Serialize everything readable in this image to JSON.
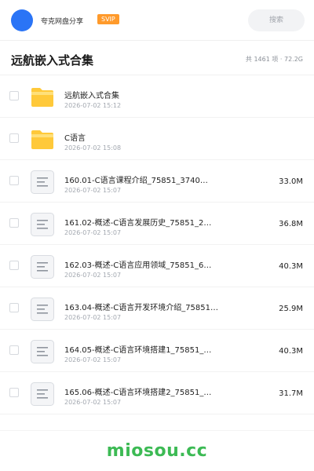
{
  "header": {
    "share_title": "夸克网盘分享",
    "badge": "SVIP",
    "search_placeholder": "搜索"
  },
  "folder": {
    "title": "远航嵌入式合集",
    "summary": "共 1461 项 · 72.2G"
  },
  "files": [
    {
      "type": "folder",
      "name": "远航嵌入式合集",
      "date": "2026-07-02 15:12",
      "size": ""
    },
    {
      "type": "folder",
      "name": "C语言",
      "date": "2026-07-02 15:08",
      "size": ""
    },
    {
      "type": "doc",
      "name": "160.01-C语言课程介绍_75851_3740…",
      "date": "2026-07-02 15:07",
      "size": "33.0M"
    },
    {
      "type": "doc",
      "name": "161.02-概述-C语言发展历史_75851_2…",
      "date": "2026-07-02 15:07",
      "size": "36.8M"
    },
    {
      "type": "doc",
      "name": "162.03-概述-C语言应用领域_75851_6…",
      "date": "2026-07-02 15:07",
      "size": "40.3M"
    },
    {
      "type": "doc",
      "name": "163.04-概述-C语言开发环境介绍_75851…",
      "date": "2026-07-02 15:07",
      "size": "25.9M"
    },
    {
      "type": "doc",
      "name": "164.05-概述-C语言环境搭建1_75851_…",
      "date": "2026-07-02 15:07",
      "size": "40.3M"
    },
    {
      "type": "doc",
      "name": "165.06-概述-C语言环境搭建2_75851_…",
      "date": "2026-07-02 15:07",
      "size": "31.7M"
    }
  ],
  "watermark": "miosou.cc",
  "colors": {
    "accent": "#2a74f6",
    "svip": "#ff9a2b",
    "folder": "#ffc93a",
    "watermark": "#3cba54"
  }
}
